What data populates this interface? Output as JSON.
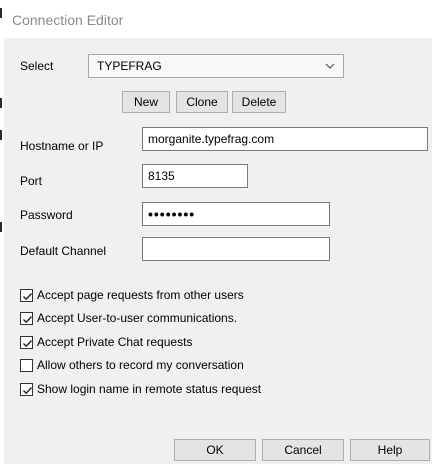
{
  "window": {
    "title": "Connection Editor"
  },
  "select": {
    "label": "Select",
    "value": "TYPEFRAG"
  },
  "buttons": {
    "new": "New",
    "clone": "Clone",
    "delete": "Delete",
    "ok": "OK",
    "cancel": "Cancel",
    "help": "Help"
  },
  "fields": {
    "hostname": {
      "label": "Hostname or IP",
      "value": "morganite.typefrag.com"
    },
    "port": {
      "label": "Port",
      "value": "8135"
    },
    "password": {
      "label": "Password",
      "value": "••••••••"
    },
    "channel": {
      "label": "Default Channel",
      "value": ""
    }
  },
  "checkboxes": [
    {
      "label": "Accept page requests from other users",
      "checked": true
    },
    {
      "label": "Accept User-to-user communications.",
      "checked": true
    },
    {
      "label": "Accept Private Chat requests",
      "checked": true
    },
    {
      "label": "Allow others to record my conversation",
      "checked": false
    },
    {
      "label": "Show login name in remote status request",
      "checked": true
    }
  ],
  "icons": {
    "dropdown": "chevron-down-icon",
    "check": "checkmark-icon"
  }
}
